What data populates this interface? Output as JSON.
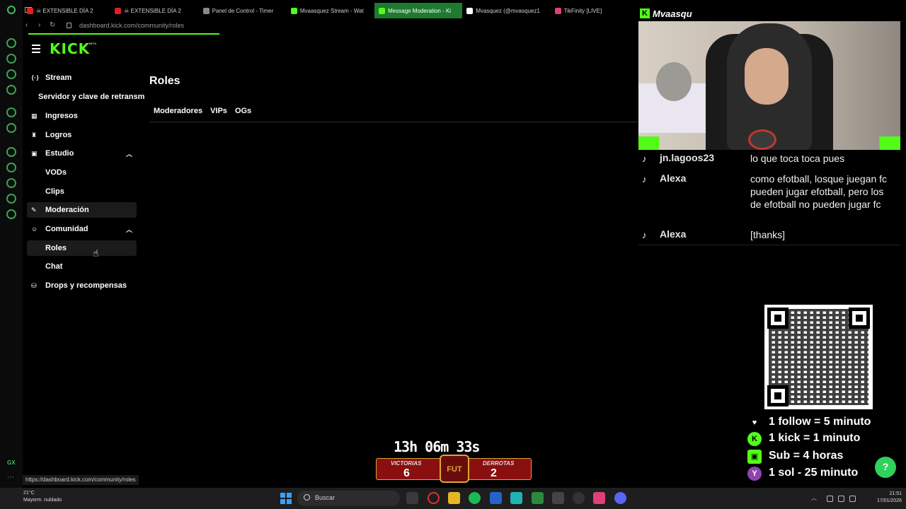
{
  "browser": {
    "tabs": [
      {
        "label": "☠ EXTENSIBLE DÍA 2",
        "color": "#e02020"
      },
      {
        "label": "☠ EXTENSIBLE DÍA 2",
        "color": "#e02020"
      },
      {
        "label": "Panel de Control - Timer",
        "color": "#888888"
      },
      {
        "label": "Mvaasquez Stream - Wat",
        "color": "#53fc18"
      },
      {
        "label": "Message Moderation - Ki",
        "color": "#53fc18",
        "active": true
      },
      {
        "label": "Mvasquez (@mvasquez1",
        "color": "#ffffff"
      },
      {
        "label": "TikFinity [LIVE]",
        "color": "#e0407a"
      }
    ],
    "url": "dashboard.kick.com/community/roles",
    "status_url": "https://dashboard.kick.com/community/roles",
    "gx_label": "GX"
  },
  "sidebar": {
    "logo": "KICK",
    "logo_beta": "BETA",
    "items": [
      {
        "label": "Stream",
        "icon": "stream-icon"
      },
      {
        "label": "Servidor y clave de retransm",
        "sub": true
      },
      {
        "label": "Ingresos",
        "icon": "revenue-icon"
      },
      {
        "label": "Logros",
        "icon": "trophy-icon"
      },
      {
        "label": "Estudio",
        "icon": "studio-icon",
        "expanded": true
      },
      {
        "label": "VODs",
        "sub": true
      },
      {
        "label": "Clips",
        "sub": true
      },
      {
        "label": "Moderación",
        "icon": "wrench-icon",
        "highlight": true
      },
      {
        "label": "Comunidad",
        "icon": "community-icon",
        "expanded": true
      },
      {
        "label": "Roles",
        "sub": true,
        "selected": true
      },
      {
        "label": "Chat",
        "sub": true
      },
      {
        "label": "Drops y recompensas",
        "icon": "drops-icon"
      }
    ]
  },
  "main": {
    "title": "Roles",
    "tabs": [
      "Moderadores",
      "VIPs",
      "OGs"
    ]
  },
  "overlay": {
    "cam_name": "Mvaasqu",
    "chat": [
      {
        "user": "jn.lagoos23",
        "message": "lo que toca toca pues"
      },
      {
        "user": "Alexa",
        "message": "como efotball, losque juegan fc pueden jugar efotball, pero los de efotball no pueden jugar fc"
      },
      {
        "user": "Alexa",
        "message": "[thanks]"
      }
    ],
    "rules": [
      {
        "text": "1 follow = 5 minuto",
        "icon": "heart-icon",
        "color": "#000000"
      },
      {
        "text": "1 kick = 1 minuto",
        "icon": "kick-icon",
        "color": "#53fc18"
      },
      {
        "text": "Sub = 4 horas",
        "icon": "gift-icon",
        "color": "#53fc18"
      },
      {
        "text": "1 sol - 25 minuto",
        "icon": "y-icon",
        "color": "#8e44ad",
        "letter": "Y"
      }
    ],
    "timer": "13h 06m 33s",
    "score": {
      "left_label": "VICTORIAS",
      "left_value": "6",
      "right_label": "DERROTAS",
      "right_value": "2",
      "badge": "FUT"
    }
  },
  "taskbar": {
    "weather_temp": "21°C",
    "weather_desc": "Mayorm. nublado",
    "search_placeholder": "Buscar",
    "time": "21:51",
    "date": "17/01/2026"
  }
}
